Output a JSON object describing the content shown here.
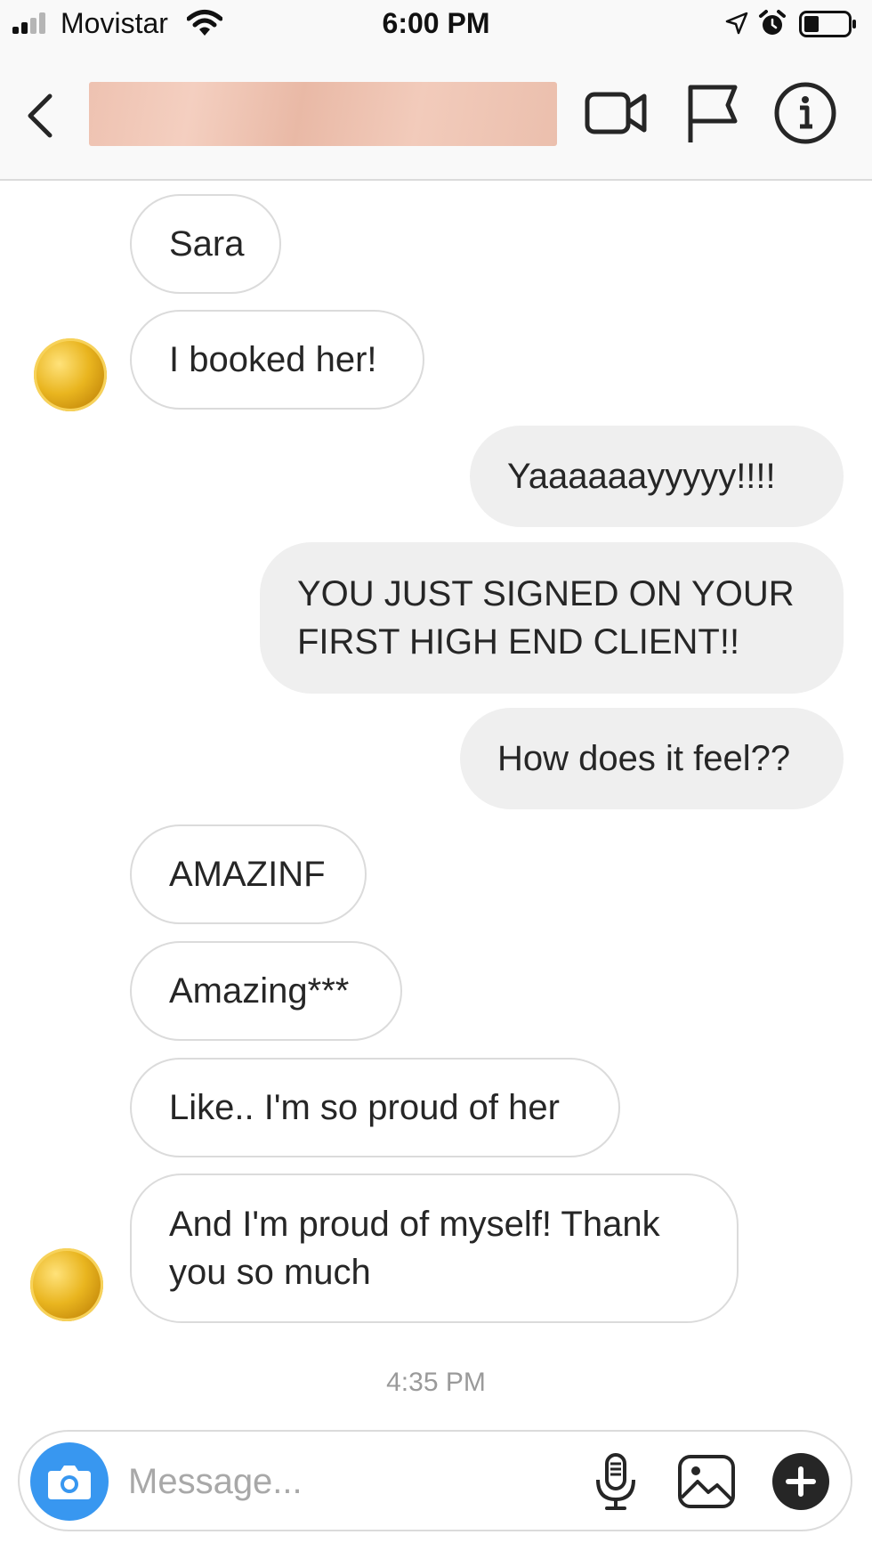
{
  "status_bar": {
    "carrier": "Movistar",
    "time": "6:00 PM"
  },
  "messages": [
    {
      "side": "in",
      "text": "Sara"
    },
    {
      "side": "in",
      "text": "I booked her!"
    },
    {
      "side": "out",
      "text": "Yaaaaaayyyyy!!!!"
    },
    {
      "side": "out",
      "text": "YOU JUST SIGNED ON YOUR FIRST HIGH END CLIENT!!"
    },
    {
      "side": "out",
      "text": "How does it feel??"
    },
    {
      "side": "in",
      "text": "AMAZINF"
    },
    {
      "side": "in",
      "text": "Amazing***"
    },
    {
      "side": "in",
      "text": "Like.. I'm so proud of her"
    },
    {
      "side": "in",
      "text": "And I'm proud of myself! Thank you so much"
    }
  ],
  "timestamp": "4:35 PM",
  "composer": {
    "placeholder": "Message..."
  },
  "colors": {
    "accent": "#3897f0",
    "outgoing_bubble": "#efefef",
    "incoming_border": "#dbdbdb"
  },
  "icons": [
    "signal-icon",
    "wifi-icon",
    "location-icon",
    "alarm-icon",
    "battery-icon",
    "back-icon",
    "video-call-icon",
    "flag-icon",
    "info-icon",
    "camera-icon",
    "microphone-icon",
    "gallery-icon",
    "plus-icon"
  ]
}
